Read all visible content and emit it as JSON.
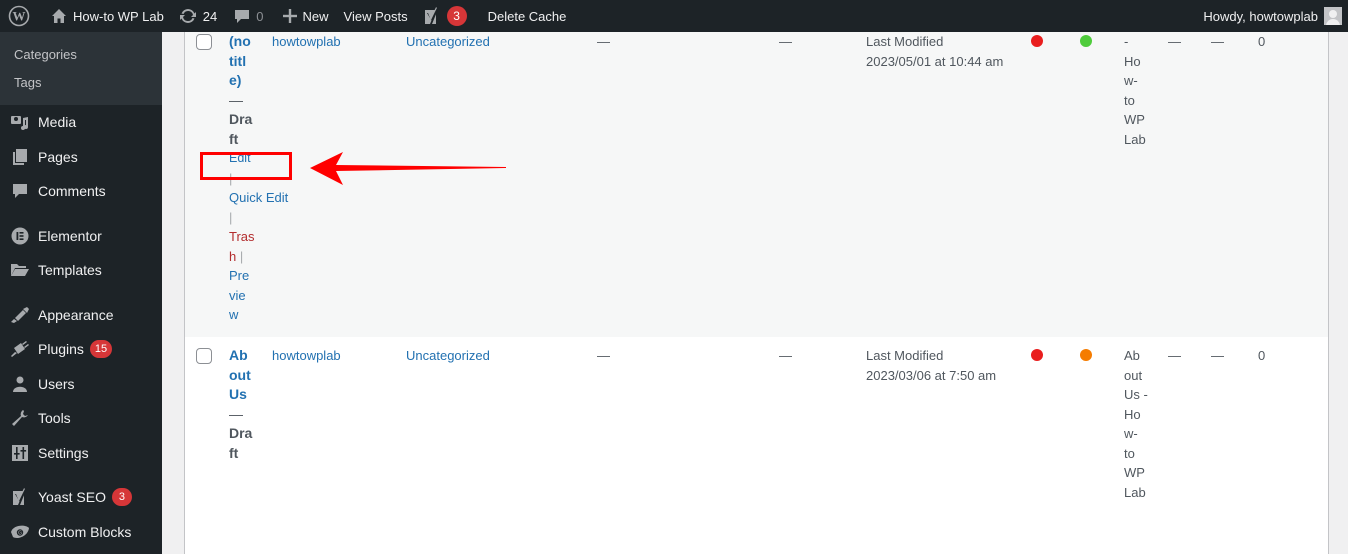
{
  "adminbar": {
    "site_name": "How-to WP Lab",
    "updates_count": "24",
    "comments_count": "0",
    "new_label": "New",
    "view_posts_label": "View Posts",
    "yoast_badge": "3",
    "delete_cache_label": "Delete Cache",
    "greeting": "Howdy, howtowplab"
  },
  "sidebar": {
    "submenu": [
      "Categories",
      "Tags"
    ],
    "items": [
      {
        "label": "Media",
        "icon": "media-icon"
      },
      {
        "label": "Pages",
        "icon": "pages-icon"
      },
      {
        "label": "Comments",
        "icon": "comments-icon"
      },
      {
        "label": "Elementor",
        "icon": "elementor-icon"
      },
      {
        "label": "Templates",
        "icon": "folder-icon"
      },
      {
        "label": "Appearance",
        "icon": "paintbrush-icon"
      },
      {
        "label": "Plugins",
        "icon": "plugin-icon",
        "badge": "15"
      },
      {
        "label": "Users",
        "icon": "user-icon"
      },
      {
        "label": "Tools",
        "icon": "wrench-icon"
      },
      {
        "label": "Settings",
        "icon": "sliders-icon"
      },
      {
        "label": "Yoast SEO",
        "icon": "yoast-icon",
        "badge": "3"
      },
      {
        "label": "Custom Blocks",
        "icon": "custom-blocks-icon"
      }
    ]
  },
  "posts": [
    {
      "title_lines": [
        "(no",
        "titl",
        "e)"
      ],
      "state_dash": "—",
      "state_lines": [
        "Dra",
        "ft"
      ],
      "actions": {
        "edit": "Edit",
        "sep": "|",
        "quick_edit": "Quick Edit",
        "trash_lines": [
          "Tras",
          "h"
        ],
        "preview_lines": [
          "Pre",
          "vie",
          "w"
        ]
      },
      "author": "howtowplab",
      "category": "Uncategorized",
      "tags": "—",
      "comments": "—",
      "date_label": "Last Modified",
      "date_value": "2023/05/01 at 10:44 am",
      "seo_status_color": "#e91e1e",
      "readability_color": "#4fcc3c",
      "seo_title_lines": [
        "-",
        "Ho",
        "w-",
        "to",
        "WP",
        "Lab"
      ],
      "col_a": "—",
      "col_b": "—",
      "links": "0"
    },
    {
      "title_lines": [
        "Ab",
        "out",
        "Us"
      ],
      "state_dash": "—",
      "state_lines": [
        "Dra",
        "ft"
      ],
      "author": "howtowplab",
      "category": "Uncategorized",
      "tags": "—",
      "comments": "—",
      "date_label": "Last Modified",
      "date_value": "2023/03/06 at 7:50 am",
      "seo_status_color": "#e91e1e",
      "readability_color": "#f57c00",
      "seo_title_lines": [
        "Ab",
        "out",
        "Us -",
        "Ho",
        "w-",
        "to",
        "WP",
        "Lab"
      ],
      "col_a": "—",
      "col_b": "—",
      "links": "0"
    }
  ],
  "annotation": {
    "highlight_color": "#ff0000",
    "target": "Edit"
  }
}
